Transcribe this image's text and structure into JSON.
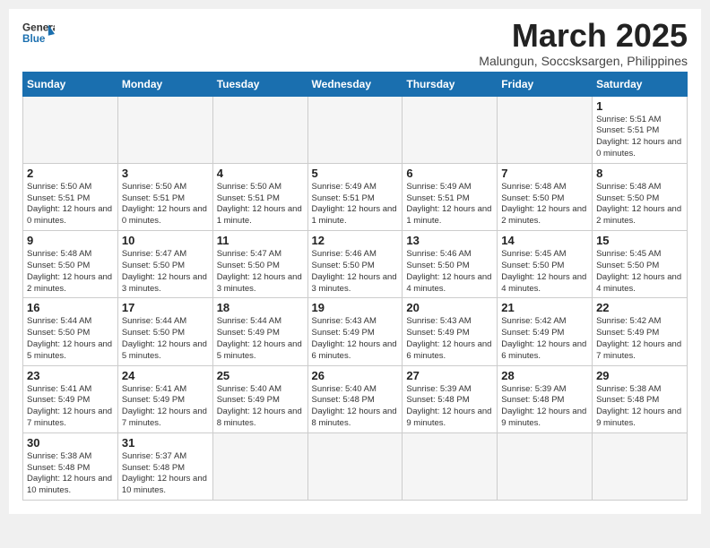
{
  "header": {
    "logo_general": "General",
    "logo_blue": "Blue",
    "month_title": "March 2025",
    "location": "Malungun, Soccsksargen, Philippines"
  },
  "weekdays": [
    "Sunday",
    "Monday",
    "Tuesday",
    "Wednesday",
    "Thursday",
    "Friday",
    "Saturday"
  ],
  "weeks": [
    [
      {
        "day": "",
        "info": ""
      },
      {
        "day": "",
        "info": ""
      },
      {
        "day": "",
        "info": ""
      },
      {
        "day": "",
        "info": ""
      },
      {
        "day": "",
        "info": ""
      },
      {
        "day": "",
        "info": ""
      },
      {
        "day": "1",
        "info": "Sunrise: 5:51 AM\nSunset: 5:51 PM\nDaylight: 12 hours\nand 0 minutes."
      }
    ],
    [
      {
        "day": "2",
        "info": "Sunrise: 5:50 AM\nSunset: 5:51 PM\nDaylight: 12 hours\nand 0 minutes."
      },
      {
        "day": "3",
        "info": "Sunrise: 5:50 AM\nSunset: 5:51 PM\nDaylight: 12 hours\nand 0 minutes."
      },
      {
        "day": "4",
        "info": "Sunrise: 5:50 AM\nSunset: 5:51 PM\nDaylight: 12 hours\nand 1 minute."
      },
      {
        "day": "5",
        "info": "Sunrise: 5:49 AM\nSunset: 5:51 PM\nDaylight: 12 hours\nand 1 minute."
      },
      {
        "day": "6",
        "info": "Sunrise: 5:49 AM\nSunset: 5:51 PM\nDaylight: 12 hours\nand 1 minute."
      },
      {
        "day": "7",
        "info": "Sunrise: 5:48 AM\nSunset: 5:50 PM\nDaylight: 12 hours\nand 2 minutes."
      },
      {
        "day": "8",
        "info": "Sunrise: 5:48 AM\nSunset: 5:50 PM\nDaylight: 12 hours\nand 2 minutes."
      }
    ],
    [
      {
        "day": "9",
        "info": "Sunrise: 5:48 AM\nSunset: 5:50 PM\nDaylight: 12 hours\nand 2 minutes."
      },
      {
        "day": "10",
        "info": "Sunrise: 5:47 AM\nSunset: 5:50 PM\nDaylight: 12 hours\nand 3 minutes."
      },
      {
        "day": "11",
        "info": "Sunrise: 5:47 AM\nSunset: 5:50 PM\nDaylight: 12 hours\nand 3 minutes."
      },
      {
        "day": "12",
        "info": "Sunrise: 5:46 AM\nSunset: 5:50 PM\nDaylight: 12 hours\nand 3 minutes."
      },
      {
        "day": "13",
        "info": "Sunrise: 5:46 AM\nSunset: 5:50 PM\nDaylight: 12 hours\nand 4 minutes."
      },
      {
        "day": "14",
        "info": "Sunrise: 5:45 AM\nSunset: 5:50 PM\nDaylight: 12 hours\nand 4 minutes."
      },
      {
        "day": "15",
        "info": "Sunrise: 5:45 AM\nSunset: 5:50 PM\nDaylight: 12 hours\nand 4 minutes."
      }
    ],
    [
      {
        "day": "16",
        "info": "Sunrise: 5:44 AM\nSunset: 5:50 PM\nDaylight: 12 hours\nand 5 minutes."
      },
      {
        "day": "17",
        "info": "Sunrise: 5:44 AM\nSunset: 5:50 PM\nDaylight: 12 hours\nand 5 minutes."
      },
      {
        "day": "18",
        "info": "Sunrise: 5:44 AM\nSunset: 5:49 PM\nDaylight: 12 hours\nand 5 minutes."
      },
      {
        "day": "19",
        "info": "Sunrise: 5:43 AM\nSunset: 5:49 PM\nDaylight: 12 hours\nand 6 minutes."
      },
      {
        "day": "20",
        "info": "Sunrise: 5:43 AM\nSunset: 5:49 PM\nDaylight: 12 hours\nand 6 minutes."
      },
      {
        "day": "21",
        "info": "Sunrise: 5:42 AM\nSunset: 5:49 PM\nDaylight: 12 hours\nand 6 minutes."
      },
      {
        "day": "22",
        "info": "Sunrise: 5:42 AM\nSunset: 5:49 PM\nDaylight: 12 hours\nand 7 minutes."
      }
    ],
    [
      {
        "day": "23",
        "info": "Sunrise: 5:41 AM\nSunset: 5:49 PM\nDaylight: 12 hours\nand 7 minutes."
      },
      {
        "day": "24",
        "info": "Sunrise: 5:41 AM\nSunset: 5:49 PM\nDaylight: 12 hours\nand 7 minutes."
      },
      {
        "day": "25",
        "info": "Sunrise: 5:40 AM\nSunset: 5:49 PM\nDaylight: 12 hours\nand 8 minutes."
      },
      {
        "day": "26",
        "info": "Sunrise: 5:40 AM\nSunset: 5:48 PM\nDaylight: 12 hours\nand 8 minutes."
      },
      {
        "day": "27",
        "info": "Sunrise: 5:39 AM\nSunset: 5:48 PM\nDaylight: 12 hours\nand 9 minutes."
      },
      {
        "day": "28",
        "info": "Sunrise: 5:39 AM\nSunset: 5:48 PM\nDaylight: 12 hours\nand 9 minutes."
      },
      {
        "day": "29",
        "info": "Sunrise: 5:38 AM\nSunset: 5:48 PM\nDaylight: 12 hours\nand 9 minutes."
      }
    ],
    [
      {
        "day": "30",
        "info": "Sunrise: 5:38 AM\nSunset: 5:48 PM\nDaylight: 12 hours\nand 10 minutes."
      },
      {
        "day": "31",
        "info": "Sunrise: 5:37 AM\nSunset: 5:48 PM\nDaylight: 12 hours\nand 10 minutes."
      },
      {
        "day": "",
        "info": ""
      },
      {
        "day": "",
        "info": ""
      },
      {
        "day": "",
        "info": ""
      },
      {
        "day": "",
        "info": ""
      },
      {
        "day": "",
        "info": ""
      }
    ]
  ]
}
